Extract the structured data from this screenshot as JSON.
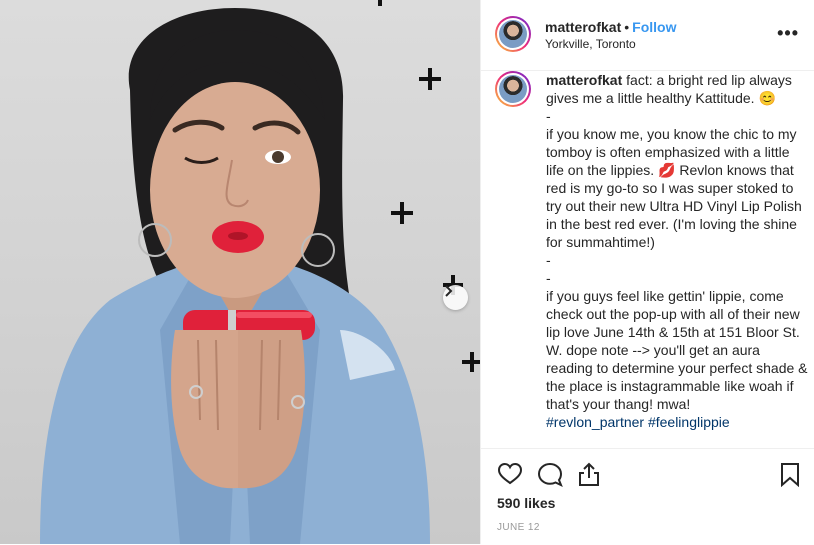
{
  "post": {
    "username": "matterofkat",
    "dot": "•",
    "follow_label": "Follow",
    "location": "Yorkville, Toronto",
    "more_label": "•••"
  },
  "caption": {
    "username": "matterofkat",
    "text": "fact: a bright red lip always gives me a little healthy Kattitude. 😊\n-\nif you know me, you know the chic to my tomboy is often emphasized with a little life on the lippies. 💋 Revlon knows that red is my go-to so I was super stoked to try out their new Ultra HD Vinyl Lip Polish in the best red ever. (I'm loving the shine for summahtime!)\n-\n-\nif you guys feel like gettin' lippie, come check out the pop-up with all of their new lip love June 14th & 15th at 151 Bloor St. W. dope note --> you'll get an aura reading to determine your perfect shade & the place is instagrammable like woah if that's your thang! mwa!",
    "hashtags": "#revlon_partner #feelinglippie"
  },
  "stats": {
    "likes": "590 likes",
    "date": "JUNE 12"
  },
  "icons": {
    "like": "heart-icon",
    "comment": "comment-icon",
    "share": "share-icon",
    "save": "bookmark-icon",
    "next": "chevron-right-icon"
  },
  "colors": {
    "lipstick": "#e0213a",
    "link": "#3897f0",
    "hashtag": "#003569",
    "denim": "#8eb0d4"
  }
}
